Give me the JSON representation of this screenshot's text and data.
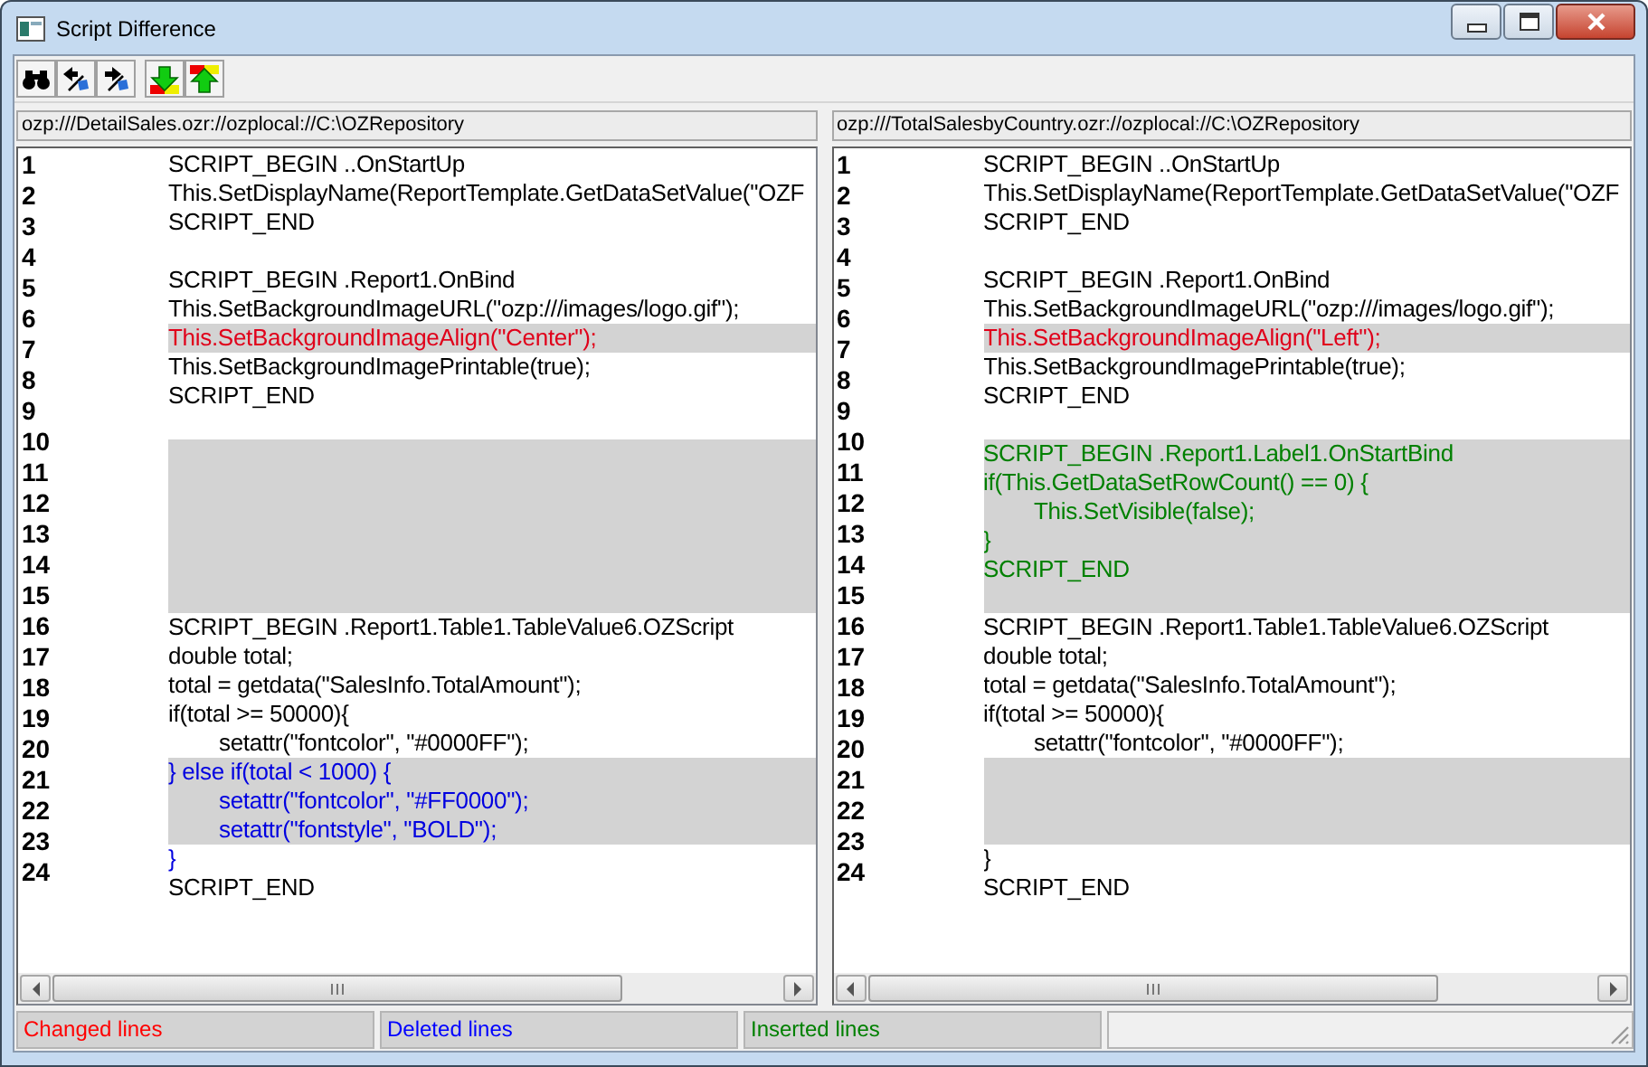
{
  "window": {
    "title": "Script Difference"
  },
  "panes": [
    {
      "path": "ozp:///DetailSales.ozr://ozplocal://C:\\OZRepository",
      "line_numbers": [
        "1",
        "2",
        "3",
        "4",
        "5",
        "6",
        "7",
        "8",
        "9",
        "10",
        "11",
        "12",
        "13",
        "14",
        "15",
        "16",
        "17",
        "18",
        "19",
        "20",
        "21",
        "22",
        "23",
        "24"
      ],
      "lines": [
        {
          "text": "SCRIPT_BEGIN ..OnStartUp",
          "kind": "normal",
          "highlighted": false
        },
        {
          "text": "This.SetDisplayName(ReportTemplate.GetDataSetValue(\"OZF",
          "kind": "normal",
          "highlighted": false
        },
        {
          "text": "SCRIPT_END",
          "kind": "normal",
          "highlighted": false
        },
        {
          "highlighted": false
        },
        {
          "text": "SCRIPT_BEGIN .Report1.OnBind",
          "kind": "normal",
          "highlighted": false
        },
        {
          "text": "This.SetBackgroundImageURL(\"ozp:///images/logo.gif\");",
          "kind": "normal",
          "highlighted": false
        },
        {
          "text": "This.SetBackgroundImageAlign(\"Center\");",
          "kind": "changed",
          "highlighted": true
        },
        {
          "text": "This.SetBackgroundImagePrintable(true);",
          "kind": "normal",
          "highlighted": false
        },
        {
          "text": "SCRIPT_END",
          "kind": "normal",
          "highlighted": false
        },
        {
          "highlighted": false
        },
        {
          "highlighted": true
        },
        {
          "highlighted": true
        },
        {
          "highlighted": true
        },
        {
          "highlighted": true
        },
        {
          "highlighted": true
        },
        {
          "highlighted": true
        },
        {
          "text": "SCRIPT_BEGIN .Report1.Table1.TableValue6.OZScript",
          "kind": "normal",
          "highlighted": false
        },
        {
          "text": "double total;",
          "kind": "normal",
          "highlighted": false
        },
        {
          "text": "total = getdata(\"SalesInfo.TotalAmount\");",
          "kind": "normal",
          "highlighted": false
        },
        {
          "text": "if(total >= 50000){",
          "kind": "normal",
          "highlighted": false
        },
        {
          "text": "setattr(\"fontcolor\", \"#0000FF\");",
          "kind": "normal",
          "highlighted": false,
          "indented": true
        },
        {
          "text": "} else if(total < 1000) {",
          "kind": "deleted",
          "highlighted": true
        },
        {
          "text": "setattr(\"fontcolor\", \"#FF0000\");",
          "kind": "deleted",
          "highlighted": true,
          "indented": true
        },
        {
          "text": "setattr(\"fontstyle\", \"BOLD\");",
          "kind": "deleted",
          "highlighted": true,
          "indented": true
        },
        {
          "text": "}",
          "kind": "deleted",
          "highlighted": false
        },
        {
          "text": "SCRIPT_END",
          "kind": "normal",
          "highlighted": false
        }
      ]
    },
    {
      "path": "ozp:///TotalSalesbyCountry.ozr://ozplocal://C:\\OZRepository",
      "line_numbers": [
        "1",
        "2",
        "3",
        "4",
        "5",
        "6",
        "7",
        "8",
        "9",
        "10",
        "11",
        "12",
        "13",
        "14",
        "15",
        "16",
        "17",
        "18",
        "19",
        "20",
        "21",
        "22",
        "23",
        "24"
      ],
      "lines": [
        {
          "text": "SCRIPT_BEGIN ..OnStartUp",
          "kind": "normal",
          "highlighted": false
        },
        {
          "text": "This.SetDisplayName(ReportTemplate.GetDataSetValue(\"OZF",
          "kind": "normal",
          "highlighted": false
        },
        {
          "text": "SCRIPT_END",
          "kind": "normal",
          "highlighted": false
        },
        {
          "highlighted": false
        },
        {
          "text": "SCRIPT_BEGIN .Report1.OnBind",
          "kind": "normal",
          "highlighted": false
        },
        {
          "text": "This.SetBackgroundImageURL(\"ozp:///images/logo.gif\");",
          "kind": "normal",
          "highlighted": false
        },
        {
          "text": "This.SetBackgroundImageAlign(\"Left\");",
          "kind": "changed",
          "highlighted": true
        },
        {
          "text": "This.SetBackgroundImagePrintable(true);",
          "kind": "normal",
          "highlighted": false
        },
        {
          "text": "SCRIPT_END",
          "kind": "normal",
          "highlighted": false
        },
        {
          "highlighted": false
        },
        {
          "text": "SCRIPT_BEGIN .Report1.Label1.OnStartBind",
          "kind": "inserted",
          "highlighted": true
        },
        {
          "text": "if(This.GetDataSetRowCount() == 0) {",
          "kind": "inserted",
          "highlighted": true
        },
        {
          "text": "This.SetVisible(false);",
          "kind": "inserted",
          "highlighted": true,
          "indented": true
        },
        {
          "text": "}",
          "kind": "inserted",
          "highlighted": true
        },
        {
          "text": "SCRIPT_END",
          "kind": "inserted",
          "highlighted": true
        },
        {
          "highlighted": true
        },
        {
          "text": "SCRIPT_BEGIN .Report1.Table1.TableValue6.OZScript",
          "kind": "normal",
          "highlighted": false
        },
        {
          "text": "double total;",
          "kind": "normal",
          "highlighted": false
        },
        {
          "text": "total = getdata(\"SalesInfo.TotalAmount\");",
          "kind": "normal",
          "highlighted": false
        },
        {
          "text": "if(total >= 50000){",
          "kind": "normal",
          "highlighted": false
        },
        {
          "text": "setattr(\"fontcolor\", \"#0000FF\");",
          "kind": "normal",
          "highlighted": false,
          "indented": true
        },
        {
          "highlighted": true
        },
        {
          "highlighted": true
        },
        {
          "highlighted": true
        },
        {
          "text": "}",
          "kind": "normal",
          "highlighted": false
        },
        {
          "text": "SCRIPT_END",
          "kind": "normal",
          "highlighted": false
        }
      ]
    }
  ],
  "status_bar": [
    {
      "text": "Changed lines",
      "color": "#ff0000"
    },
    {
      "text": "Deleted lines",
      "color": "#0000ff"
    },
    {
      "text": "Inserted lines",
      "color": "#008000"
    }
  ]
}
